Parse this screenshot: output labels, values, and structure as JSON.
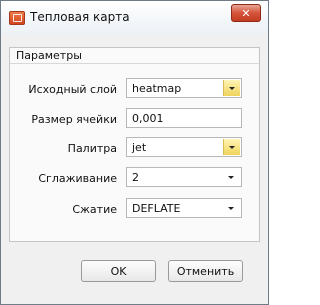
{
  "window": {
    "title": "Тепловая карта",
    "close_glyph": "✕"
  },
  "group": {
    "title": "Параметры"
  },
  "fields": [
    {
      "label": "Исходный слой",
      "value": "heatmap",
      "control": "combo-editable"
    },
    {
      "label": "Размер ячейки",
      "value": "0,001",
      "control": "text-input"
    },
    {
      "label": "Палитра",
      "value": "jet",
      "control": "combo-editable"
    },
    {
      "label": "Сглаживание",
      "value": "2",
      "control": "combo"
    },
    {
      "label": "Сжатие",
      "value": "DEFLATE",
      "control": "combo"
    }
  ],
  "buttons": {
    "ok": "OK",
    "cancel": "Отменить"
  },
  "colors": {
    "dropdown_accent": "#f0d35b",
    "close_button": "#c33d21"
  }
}
